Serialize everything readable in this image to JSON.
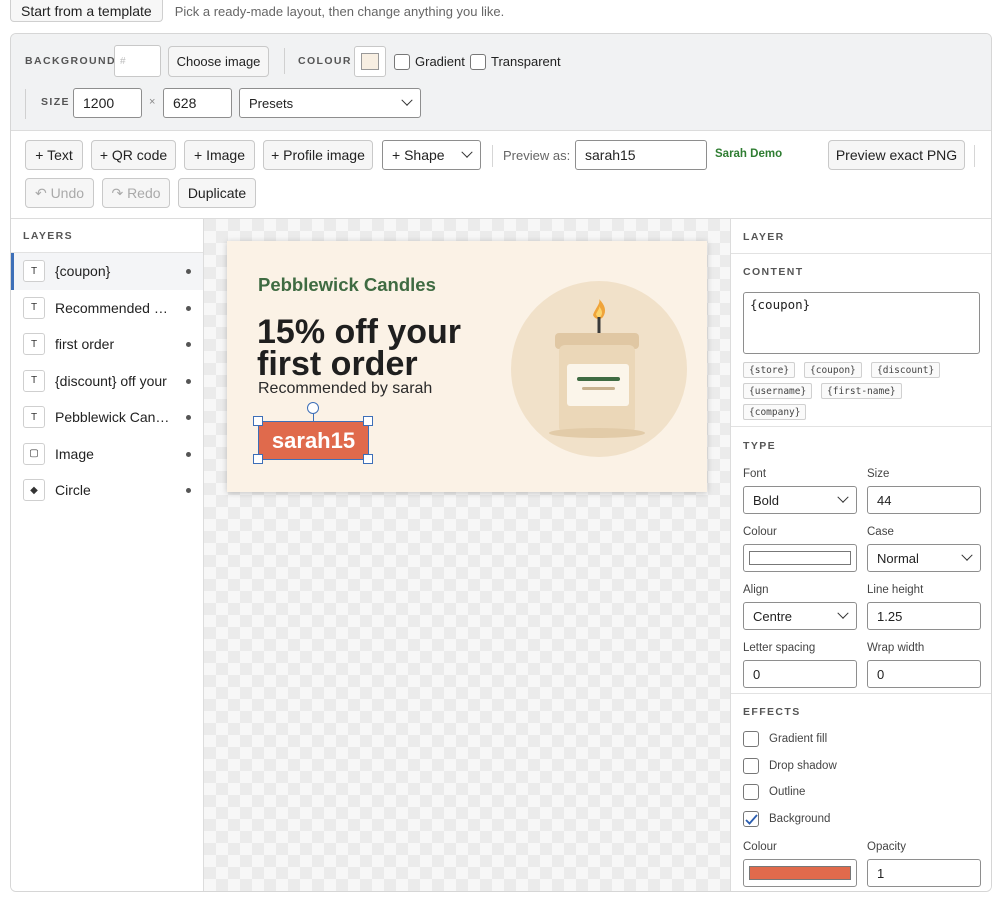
{
  "top": {
    "template_button": "Start from a template",
    "hint": "Pick a ready-made layout, then change anything you like."
  },
  "background": {
    "label": "BACKGROUND",
    "hash_placeholder": "#",
    "choose_image": "Choose image",
    "colour_label": "COLOUR",
    "colour_value": "#f8efe2",
    "gradient_label": "Gradient",
    "transparent_label": "Transparent",
    "size_label": "SIZE",
    "width": "1200",
    "times": "×",
    "height": "628",
    "presets": "Presets"
  },
  "toolbar": {
    "add_text": "+ Text",
    "add_qr": "+ QR code",
    "add_image": "+ Image",
    "add_profile": "+ Profile image",
    "add_shape": "+ Shape",
    "preview_as_label": "Preview as:",
    "preview_as_value": "sarah15",
    "preview_user": "Sarah Demo",
    "preview_png": "Preview exact PNG",
    "undo": "↶ Undo",
    "redo": "↷ Redo",
    "duplicate": "Duplicate"
  },
  "layers": {
    "title": "LAYERS",
    "items": [
      {
        "type": "T",
        "label": "{coupon}",
        "active": true
      },
      {
        "type": "T",
        "label": "Recommended by {first-name}",
        "active": false
      },
      {
        "type": "T",
        "label": "first order",
        "active": false
      },
      {
        "type": "T",
        "label": "{discount} off your",
        "active": false
      },
      {
        "type": "T",
        "label": "Pebblewick Candles",
        "active": false
      },
      {
        "type": "▢",
        "label": "Image",
        "active": false
      },
      {
        "type": "◆",
        "label": "Circle",
        "active": false
      }
    ]
  },
  "artboard": {
    "brand": "Pebblewick Candles",
    "headline_1": "15% off your",
    "headline_2": "first order",
    "recommended": "Recommended by sarah",
    "coupon": "sarah15"
  },
  "props": {
    "layer_title": "LAYER",
    "content_title": "CONTENT",
    "content_value": "{coupon}",
    "chips": [
      "{store}",
      "{coupon}",
      "{discount}",
      "{username}",
      "{first-name}",
      "{company}"
    ],
    "type_title": "TYPE",
    "font_label": "Font",
    "font_value": "Bold",
    "size_label": "Size",
    "size_value": "44",
    "colour_label": "Colour",
    "colour_value": "#ffffff",
    "case_label": "Case",
    "case_value": "Normal",
    "align_label": "Align",
    "align_value": "Centre",
    "line_height_label": "Line height",
    "line_height_value": "1.25",
    "letter_spacing_label": "Letter spacing",
    "letter_spacing_value": "0",
    "wrap_width_label": "Wrap width",
    "wrap_width_value": "0",
    "effects_title": "EFFECTS",
    "effects": [
      {
        "label": "Gradient fill",
        "checked": false
      },
      {
        "label": "Drop shadow",
        "checked": false
      },
      {
        "label": "Outline",
        "checked": false
      },
      {
        "label": "Background",
        "checked": true
      }
    ],
    "bg_colour_label": "Colour",
    "bg_colour_value": "#e06a4c",
    "opacity_label": "Opacity",
    "opacity_value": "1"
  }
}
